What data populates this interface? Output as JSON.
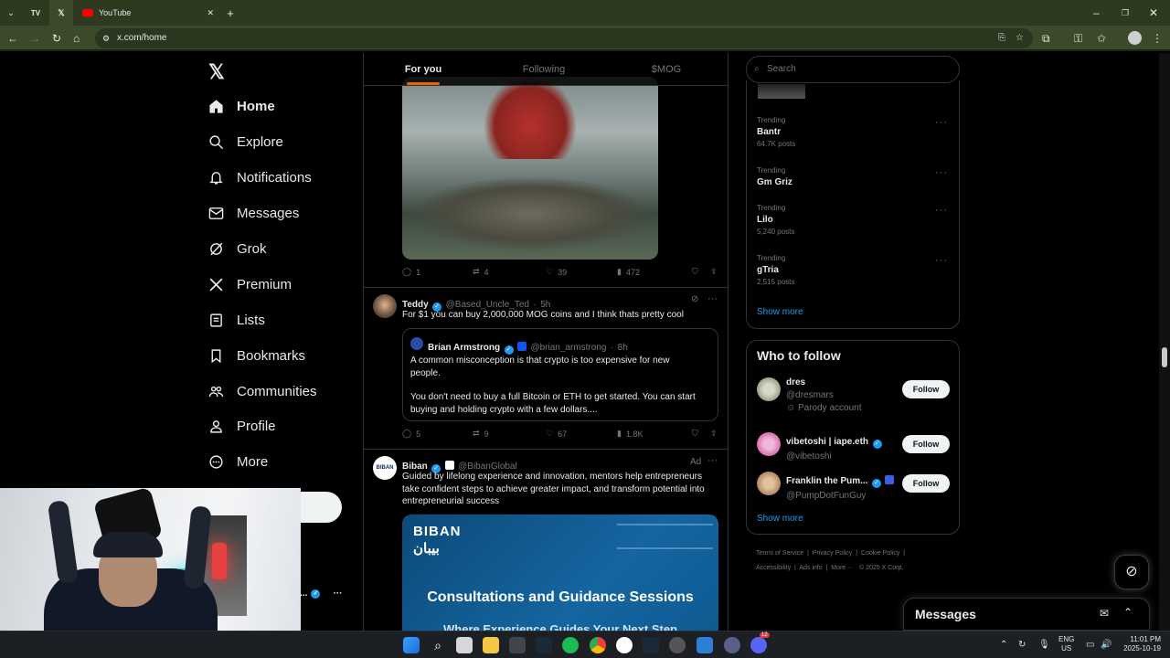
{
  "browser": {
    "tabs": [
      {
        "label": "YouTube"
      }
    ],
    "url": "x.com/home"
  },
  "sidebar": {
    "items": [
      {
        "label": "Home",
        "icon": "home-icon"
      },
      {
        "label": "Explore",
        "icon": "search-icon"
      },
      {
        "label": "Notifications",
        "icon": "bell-icon"
      },
      {
        "label": "Messages",
        "icon": "envelope-icon"
      },
      {
        "label": "Grok",
        "icon": "grok-icon"
      },
      {
        "label": "Premium",
        "icon": "x-logo-icon"
      },
      {
        "label": "Lists",
        "icon": "list-icon"
      },
      {
        "label": "Bookmarks",
        "icon": "bookmark-icon"
      },
      {
        "label": "Communities",
        "icon": "communities-icon"
      },
      {
        "label": "Profile",
        "icon": "person-icon"
      },
      {
        "label": "More",
        "icon": "more-circle-icon"
      }
    ],
    "account_name_fragment": "g..."
  },
  "feed": {
    "tabs": [
      {
        "label": "For you"
      },
      {
        "label": "Following"
      },
      {
        "label": "$MOG"
      }
    ],
    "first_post_stats": {
      "replies": "1",
      "reposts": "4",
      "likes": "39",
      "views": "472"
    },
    "post2": {
      "name": "Teddy",
      "handle": "@Based_Uncle_Ted",
      "time": "5h",
      "text": "For $1 you can buy 2,000,000 MOG coins and I think thats pretty cool",
      "quote": {
        "name": "Brian Armstrong",
        "handle": "@brian_armstrong",
        "time": "8h",
        "text1": "A common misconception is that crypto is too expensive for new people.",
        "text2": "You don't need to buy a full Bitcoin or ETH to get started. You can start buying and holding crypto with a few dollars...."
      },
      "stats": {
        "replies": "5",
        "reposts": "9",
        "likes": "67",
        "views": "1.8K"
      }
    },
    "post3": {
      "name": "Biban",
      "handle": "@BibanGlobal",
      "ad": "Ad",
      "text": "Guided by lifelong experience and innovation, mentors help entrepreneurs take confident steps to achieve greater impact, and transform potential into entrepreneurial success",
      "card_logo": "BIBAN",
      "card_logo_ar": "بيبان",
      "card_title": "Consultations and Guidance Sessions",
      "card_sub": "Where Experience Guides Your Next Step"
    }
  },
  "right": {
    "search_placeholder": "Search",
    "trends": [
      {
        "label": "Trending",
        "name": "Bantr",
        "posts": "64.7K posts"
      },
      {
        "label": "Trending",
        "name": "Gm Griz",
        "posts": ""
      },
      {
        "label": "Trending",
        "name": "Lilo",
        "posts": "5,240 posts"
      },
      {
        "label": "Trending",
        "name": "gTria",
        "posts": "2,515 posts"
      }
    ],
    "show_more": "Show more",
    "wtf_title": "Who to follow",
    "follows": [
      {
        "name": "dres",
        "handle": "@dresmars",
        "extra": "Parody account"
      },
      {
        "name": "vibetoshi | iape.eth",
        "handle": "@vibetoshi",
        "extra": ""
      },
      {
        "name": "Franklin the Pum...",
        "handle": "@PumpDotFunGuy",
        "extra": ""
      }
    ],
    "follow_label": "Follow",
    "footer": [
      "Terms of Service",
      "Privacy Policy",
      "Cookie Policy",
      "Accessibility",
      "Ads info",
      "More ···",
      "© 2025 X Corp."
    ]
  },
  "messages_drawer": {
    "title": "Messages"
  },
  "taskbar": {
    "lang1": "ENG",
    "lang2": "US",
    "time": "11:01 PM",
    "date": "2025-10-19",
    "discord_badge": "12"
  },
  "colors": {
    "accent": "#e8630a",
    "verified": "#1d9bf0",
    "browser_frame": "#3b4a2a"
  }
}
